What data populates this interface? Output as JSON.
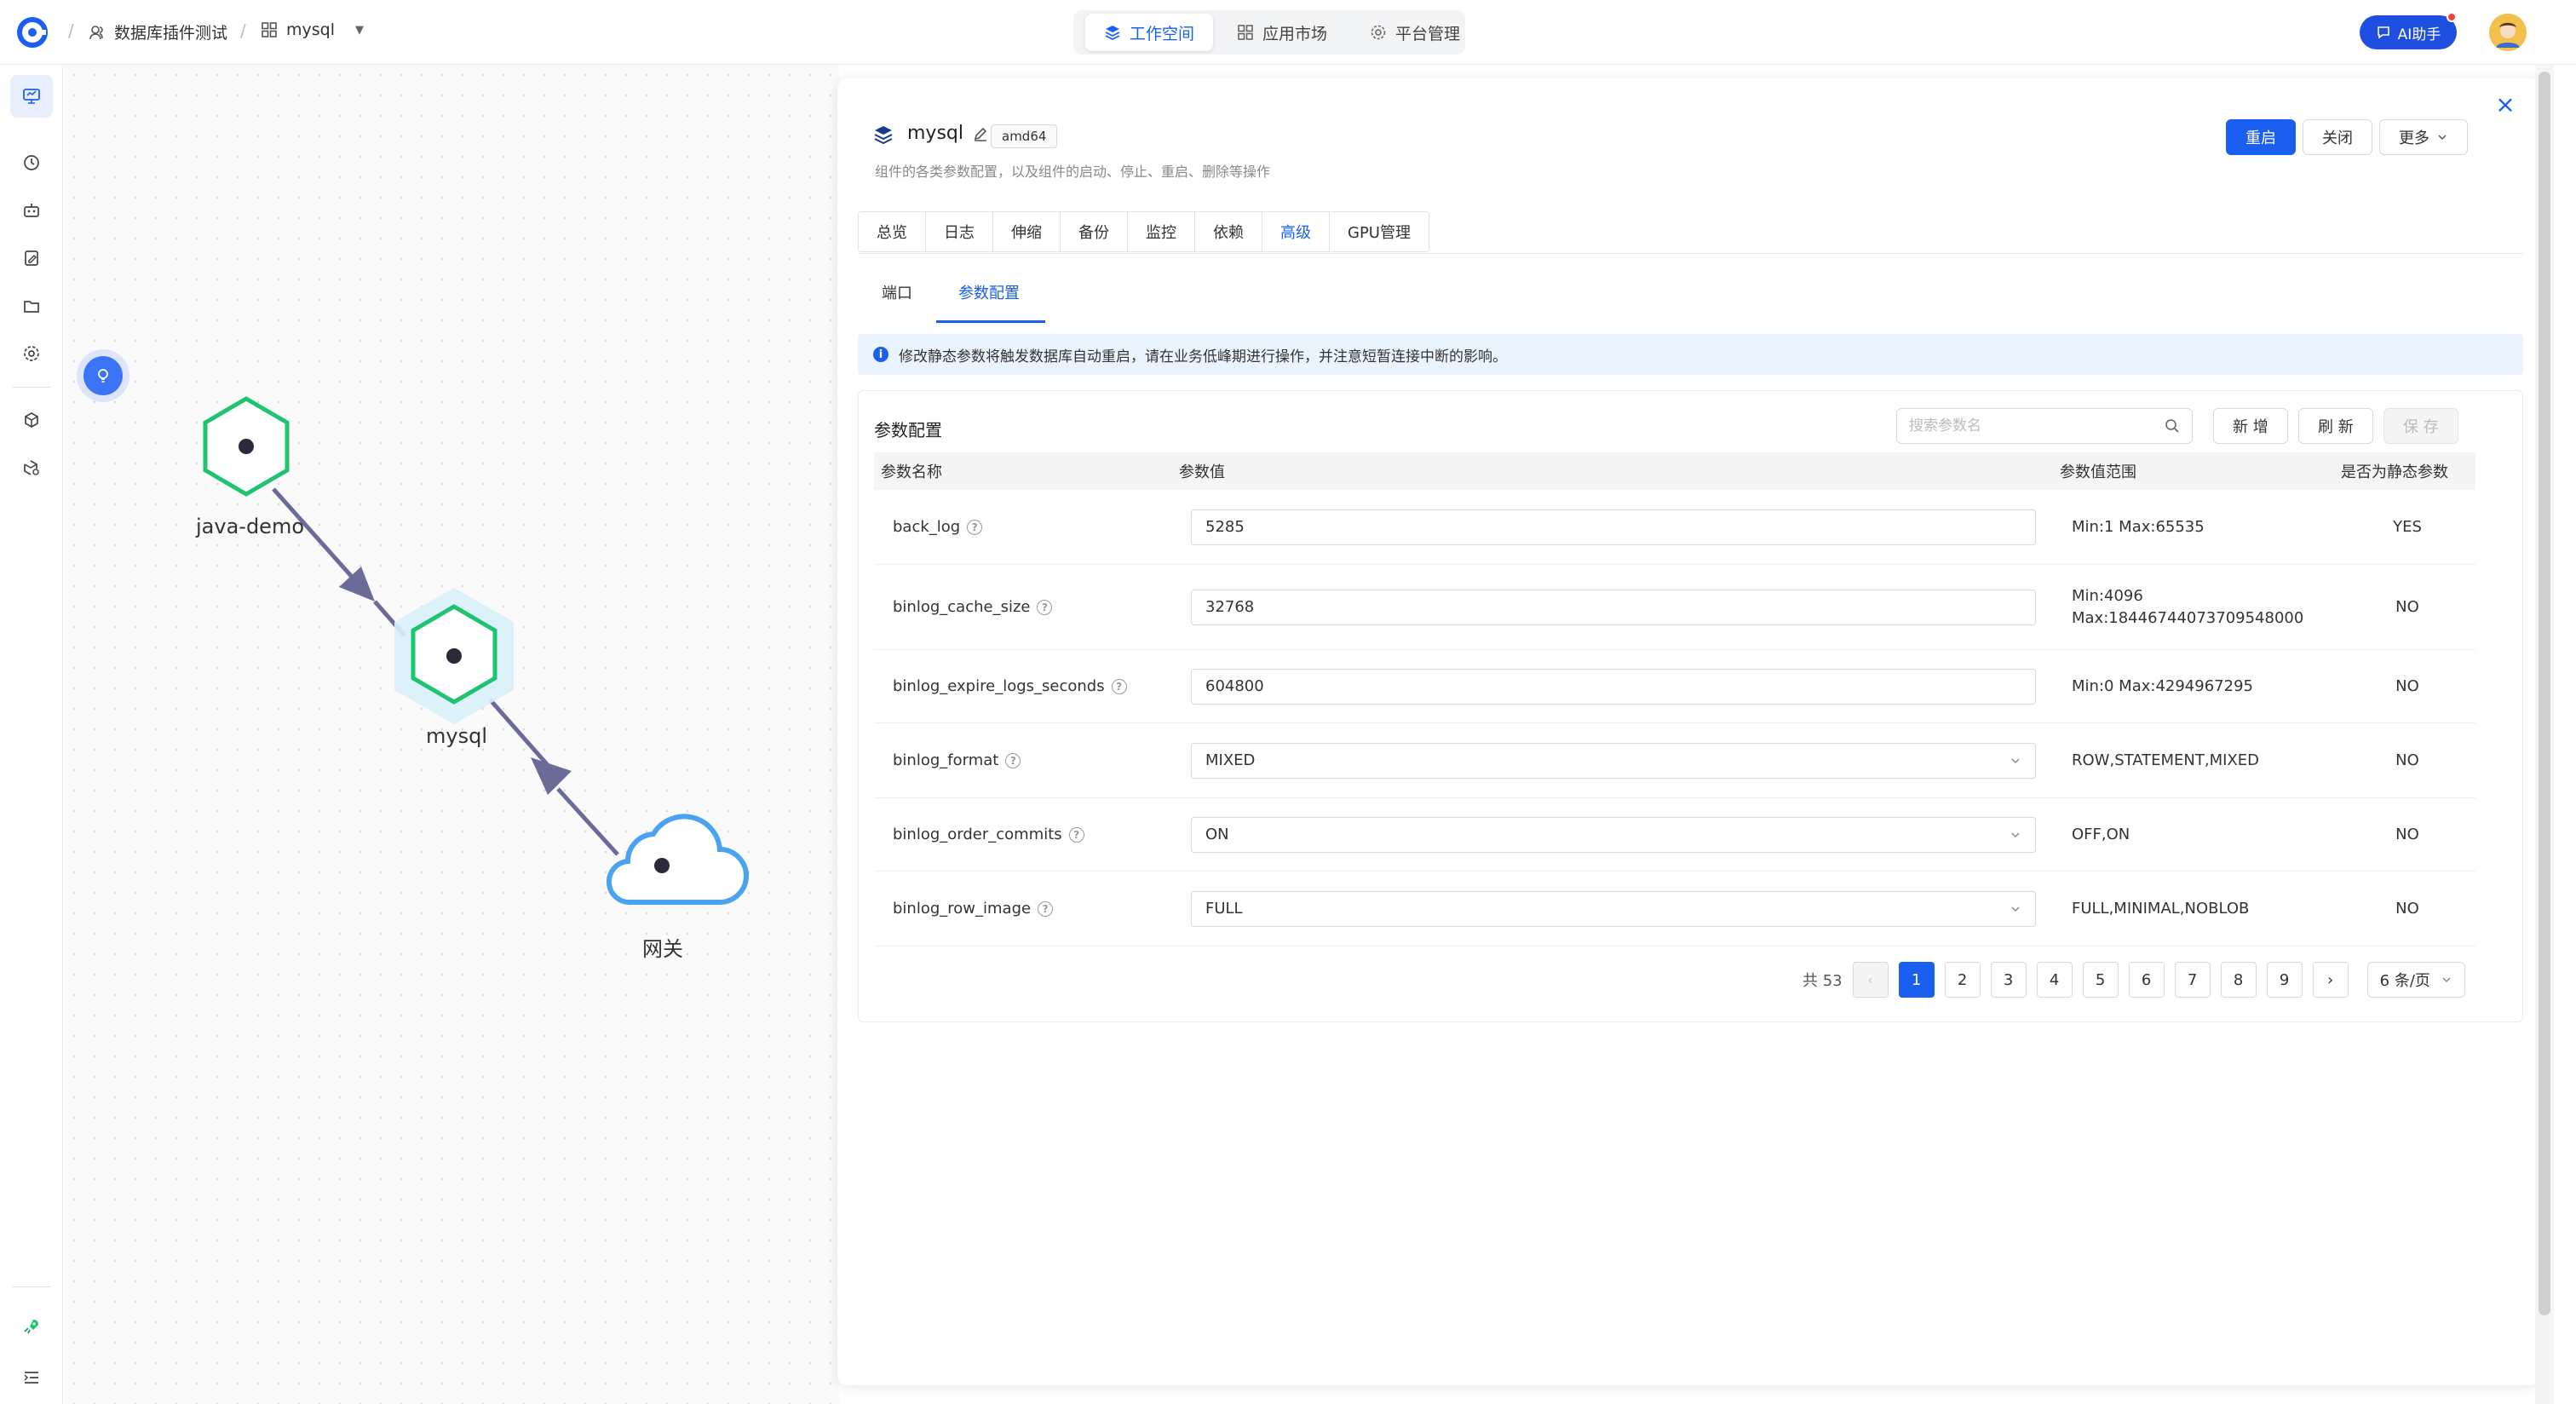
{
  "breadcrumb": {
    "team": "数据库插件测试",
    "app": "mysql"
  },
  "nav": {
    "items": [
      {
        "label": "工作空间",
        "active": true
      },
      {
        "label": "应用市场",
        "active": false
      },
      {
        "label": "平台管理",
        "active": false
      }
    ]
  },
  "header": {
    "ai_label": "AI助手"
  },
  "topology": {
    "nodes": [
      {
        "label": "java-demo"
      },
      {
        "label": "mysql"
      },
      {
        "label": "网关"
      }
    ]
  },
  "panel": {
    "title": "mysql",
    "arch_badge": "amd64",
    "description": "组件的各类参数配置，以及组件的启动、停止、重启、删除等操作",
    "actions": {
      "restart": "重启",
      "close": "关闭",
      "more": "更多"
    },
    "tabs": [
      "总览",
      "日志",
      "伸缩",
      "备份",
      "监控",
      "依赖",
      "高级",
      "GPU管理"
    ],
    "active_tab": "高级",
    "subtabs": [
      "端口",
      "参数配置"
    ],
    "active_subtab": "参数配置",
    "alert": "修改静态参数将触发数据库自动重启，请在业务低峰期进行操作，并注意短暂连接中断的影响。"
  },
  "params": {
    "title": "参数配置",
    "search_placeholder": "搜索参数名",
    "buttons": {
      "add": "新 增",
      "refresh": "刷 新",
      "save": "保 存"
    },
    "columns": {
      "name": "参数名称",
      "value": "参数值",
      "range": "参数值范围",
      "static": "是否为静态参数"
    },
    "rows": [
      {
        "name": "back_log",
        "value": "5285",
        "type": "input",
        "range": "Min:1 Max:65535",
        "static": "YES"
      },
      {
        "name": "binlog_cache_size",
        "value": "32768",
        "type": "input",
        "range": "Min:4096 Max:18446744073709548000",
        "range_line1": "Min:4096",
        "range_line2": "Max:18446744073709548000",
        "static": "NO"
      },
      {
        "name": "binlog_expire_logs_seconds",
        "value": "604800",
        "type": "input",
        "range": "Min:0 Max:4294967295",
        "static": "NO"
      },
      {
        "name": "binlog_format",
        "value": "MIXED",
        "type": "select",
        "range": "ROW,STATEMENT,MIXED",
        "static": "NO"
      },
      {
        "name": "binlog_order_commits",
        "value": "ON",
        "type": "select",
        "range": "OFF,ON",
        "static": "NO"
      },
      {
        "name": "binlog_row_image",
        "value": "FULL",
        "type": "select",
        "range": "FULL,MINIMAL,NOBLOB",
        "static": "NO"
      }
    ],
    "pagination": {
      "total_label": "共 53",
      "pages": [
        "1",
        "2",
        "3",
        "4",
        "5",
        "6",
        "7",
        "8",
        "9"
      ],
      "current": "1",
      "page_size": "6 条/页"
    }
  },
  "colors": {
    "primary": "#1a5ff0",
    "node_green": "#1ec46f",
    "cloud_blue": "#4aa3f0",
    "edge": "#6b6b99"
  }
}
